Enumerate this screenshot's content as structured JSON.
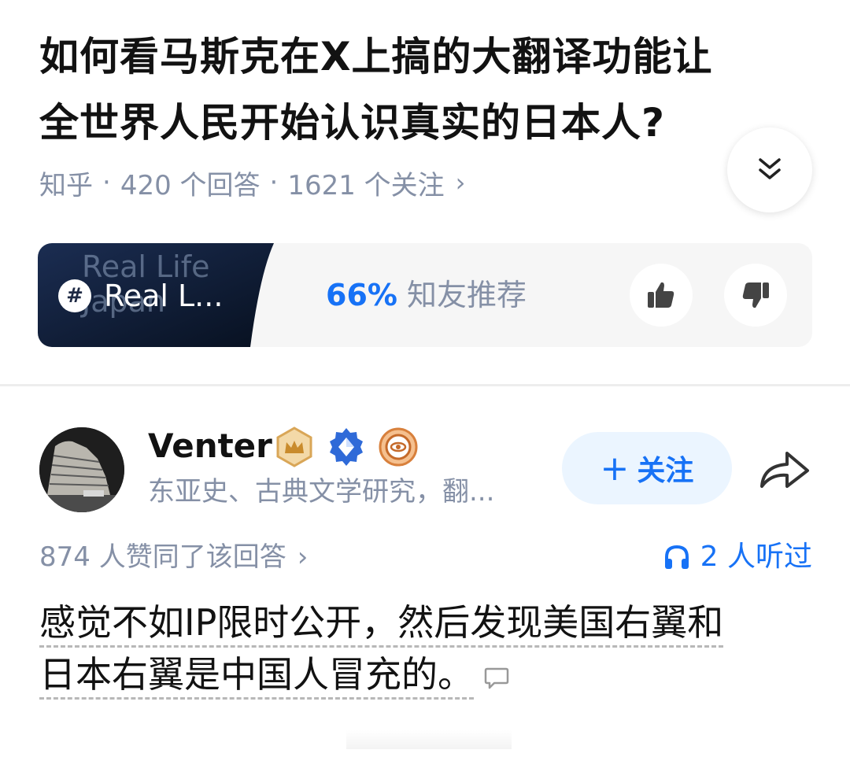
{
  "question": {
    "title_line1": "如何看马斯克在X上搞的大翻译功能让",
    "title_line2": "全世界人民开始认识真实的日本人?",
    "source": "知乎",
    "answers_count": "420 个回答",
    "followers_count": "1621 个关注",
    "separator": "·",
    "chevron": "›"
  },
  "topic_card": {
    "ghost_text": "Real Life Japan",
    "name": "Real L...",
    "hash": "#",
    "recommend_pct": "66%",
    "recommend_label": "知友推荐"
  },
  "author": {
    "name": "Venter",
    "bio": "东亚史、古典文学研究，翻...",
    "follow_label": "关注",
    "follow_plus": "+"
  },
  "answer": {
    "agree_text": "874 人赞同了该回答",
    "agree_chevron": "›",
    "listen_text": "2 人听过",
    "line1": "感觉不如IP限时公开，然后发现美国右翼和",
    "line2": "日本右翼是中国人冒充的。"
  },
  "icons": {
    "expand": "double-chevron-down-icon",
    "thumbs_up": "thumbs-up-icon",
    "thumbs_down": "thumbs-down-icon",
    "share": "share-arrow-icon",
    "headphones": "headphones-icon",
    "comment": "comment-bubble-icon",
    "badge1": "crown-badge-icon",
    "badge2": "diamond-badge-icon",
    "badge3": "eye-badge-icon"
  },
  "colors": {
    "accent": "#1772f6",
    "muted": "#8590a6",
    "follow_bg": "#ebf5ff",
    "card_bg": "#f6f6f6",
    "thumb_dark": "#0f1e3a"
  }
}
